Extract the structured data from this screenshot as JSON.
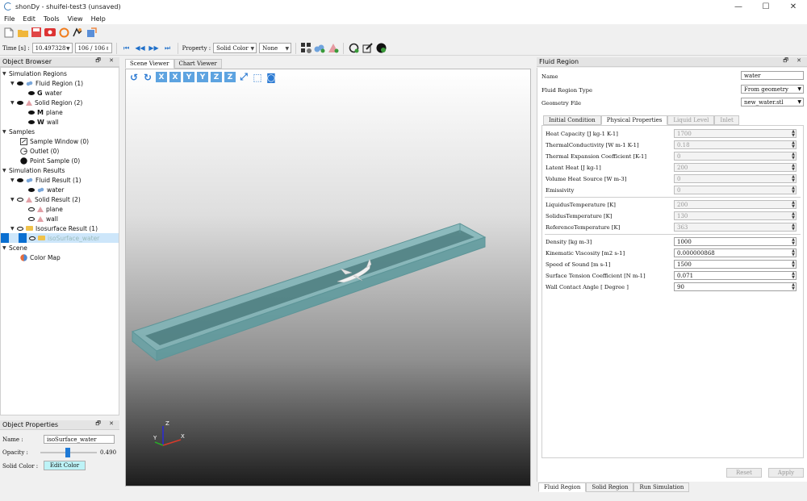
{
  "window": {
    "title": "shonDy - shuifei-test3 (unsaved)",
    "controls": [
      "—",
      "☐",
      "✕"
    ]
  },
  "menu": [
    "File",
    "Edit",
    "Tools",
    "View",
    "Help"
  ],
  "toolbar": {
    "time_label": "Time [s] :",
    "time_value": "10.497328",
    "frame_value": "106 / 106",
    "property_label": "Property :",
    "property_value": "Solid Color",
    "component_value": "None"
  },
  "object_browser": {
    "title": "Object Browser",
    "items": [
      "Simulation Regions",
      "Fluid Region (1)",
      "water",
      "Solid Region (2)",
      "plane",
      "wall",
      "Samples",
      "Sample Window (0)",
      "Outlet (0)",
      "Point Sample (0)",
      "Simulation Results",
      "Fluid Result (1)",
      "water",
      "Solid Result (2)",
      "plane",
      "wall",
      "Isosurface Result (1)",
      "isoSurface_water",
      "Scene",
      "Color Map"
    ]
  },
  "object_properties": {
    "title": "Object Properties",
    "name_label": "Name :",
    "name_value": "isoSurface_water",
    "opacity_label": "Opacity :",
    "opacity_value": "0.490",
    "opacity_fraction": 0.49,
    "solid_color_label": "Solid Color :",
    "edit_color_label": "Edit Color",
    "solid_color": "#bdf3f7"
  },
  "viewer": {
    "tabs": [
      "Scene Viewer",
      "Chart Viewer"
    ],
    "view_tools": [
      "X",
      "X",
      "Y",
      "Y",
      "Z",
      "Z"
    ],
    "axes": {
      "z": "Z",
      "y": "Y",
      "x": "X"
    }
  },
  "fluid_region": {
    "title": "Fluid Region",
    "name_label": "Name",
    "name_value": "water",
    "type_label": "Fluid Region Type",
    "type_value": "From geometry",
    "geometry_label": "Geometry File",
    "geometry_value": "new_water.stl",
    "tabs": [
      "Initial Condition",
      "Physical Properties",
      "Liquid Level",
      "Inlet"
    ],
    "properties_a": [
      {
        "label": "Heat Capacity [J kg-1 K-1]",
        "value": "1700"
      },
      {
        "label": "ThermalConductivity [W m-1 K-1]",
        "value": "0.18"
      },
      {
        "label": "Thermal Expansion Coefficient [K-1]",
        "value": "0"
      },
      {
        "label": "Latent Heat [J kg-1]",
        "value": "200"
      },
      {
        "label": "Volume Heat Source [W m-3]",
        "value": "0"
      },
      {
        "label": "Emissivity",
        "value": "0"
      }
    ],
    "properties_b": [
      {
        "label": "LiquidusTemperature [K]",
        "value": "200"
      },
      {
        "label": "SolidusTemperature [K]",
        "value": "130"
      },
      {
        "label": "ReferenceTemperature [K]",
        "value": "363"
      }
    ],
    "properties_c": [
      {
        "label": "Density [kg m-3]",
        "value": "1000"
      },
      {
        "label": "Kinematic Viscosity [m2 s-1]",
        "value": "0.000000868"
      },
      {
        "label": "Speed of Sound [m s-1]",
        "value": "1500"
      },
      {
        "label": "Surface Tension Coefficient [N m-1]",
        "value": "0.071"
      },
      {
        "label": "Wall Contact Angle [ Degree ]",
        "value": "90"
      }
    ],
    "reset_label": "Reset",
    "apply_label": "Apply"
  },
  "bottom_tabs": [
    "Fluid Region",
    "Solid Region",
    "Run Simulation"
  ]
}
